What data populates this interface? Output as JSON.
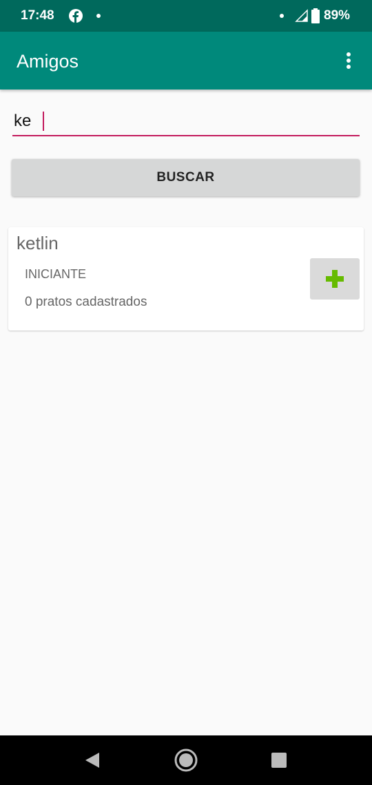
{
  "status_bar": {
    "time": "17:48",
    "battery": "89%",
    "icons": [
      "facebook-icon",
      "notification-dot-icon",
      "signal-icon",
      "battery-icon"
    ]
  },
  "app_bar": {
    "title": "Amigos",
    "overflow_icon": "more-vert-icon"
  },
  "search": {
    "value": "ke",
    "accent_color": "#c2185b"
  },
  "search_button": {
    "label": "BUSCAR"
  },
  "results": [
    {
      "name": "ketlin",
      "level": "INICIANTE",
      "dishes": "0 pratos cadastrados",
      "action_icon": "plus-icon"
    }
  ],
  "colors": {
    "status_bar": "#00695c",
    "app_bar": "#00897b",
    "plus": "#66bb00"
  },
  "nav_bar": {
    "icons": [
      "back-icon",
      "home-icon",
      "recents-icon"
    ]
  }
}
